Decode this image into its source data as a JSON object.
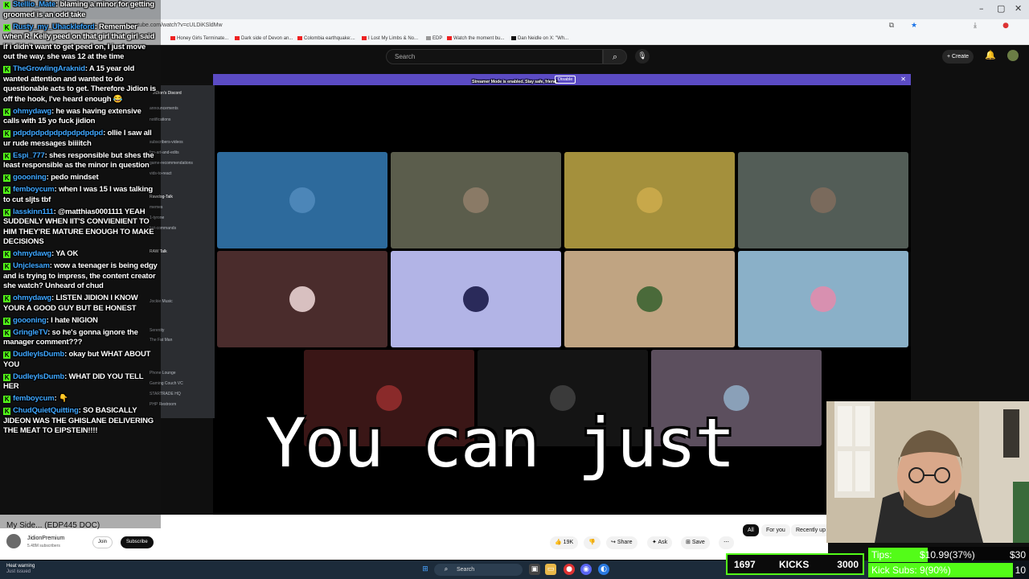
{
  "browser": {
    "url": "youtube.com/watch?v=cULDiKSldMw",
    "window_controls": [
      "–",
      "▢",
      "✕"
    ],
    "bookmarks": [
      "Honey Girls Terminate...",
      "Dark side of Devon an...",
      "Colombia earthquake:...",
      "I Lost My Limbs & No...",
      "EDP",
      "Watch the moment bu...",
      "Dan Neidle on X: \"Wh..."
    ]
  },
  "youtube": {
    "search_placeholder": "Search",
    "create_label": "+ Create",
    "video_title": "My Side... (EDP445 DOC)",
    "channel_name": "JidionPremium",
    "channel_subs": "5.48M subscribers",
    "join_label": "Join",
    "subscribe_label": "Subscribe",
    "like_count": "19K",
    "share_label": "Share",
    "ask_label": "Ask",
    "save_label": "Save",
    "chips": [
      "All",
      "For you",
      "Recently up"
    ]
  },
  "discord": {
    "streamer_msg": "Streamer Mode is enabled. Stay safe, friend.",
    "disable_label": "Disable",
    "server_name": "JiDion's Discord",
    "channels": [
      "announcements",
      "notifications",
      "subscribers-videos",
      "fan-art-and-edits",
      "game-recommendations",
      "vids-to-react",
      "Rawdog-Talk",
      "memes",
      "1-tyrone",
      "bot-commands",
      "RAW Talk",
      "Jockie Music",
      "Serenity",
      "The Fat Man",
      "Phone Lounge",
      "Gaming Couch VC",
      "STARTRADE HQ",
      "PHP Restroom"
    ]
  },
  "tiles": [
    {
      "bg": "#2d6a9c",
      "av": "#4c86b8"
    },
    {
      "bg": "#5b5d4c",
      "av": "#8a7a66"
    },
    {
      "bg": "#a4903c",
      "av": "#c8a84a"
    },
    {
      "bg": "#535d57",
      "av": "#7a6a5c"
    },
    {
      "bg": "#4a2c2c",
      "av": "#d8c0c0"
    },
    {
      "bg": "#b2b4e6",
      "av": "#2a2a5a"
    },
    {
      "bg": "#c0a482",
      "av": "#4a6a3a"
    },
    {
      "bg": "#8ab0c8",
      "av": "#d890b0"
    },
    {
      "bg": "#3a1616",
      "av": "#8a2a2a"
    },
    {
      "bg": "#141414",
      "av": "#3a3a3a"
    },
    {
      "bg": "#5c4f5e",
      "av": "#8aa0b8"
    }
  ],
  "subtitle": "You can just",
  "chat": [
    {
      "user": "Stellio_Mate",
      "text": "blaming a minor for getting groomed is an odd take"
    },
    {
      "user": "Rusty_my_Uhackleford",
      "text": "Remember when R. Kelly peed on that girl that girl said if i didn't want to get peed on, I just move out the way. she was 12 at the time"
    },
    {
      "user": "TheGrowlingAraknid",
      "text": "A 15 year old wanted attention and wanted to do questionable acts to get. Therefore Jidion is off the hook, I've heard enough 😂"
    },
    {
      "user": "ohmydawg",
      "text": "he was having extensive calls with 15 yo fuck jidion"
    },
    {
      "user": "pdpdpdpdpdpdpdpdpdpd",
      "text": "ollie I saw all ur rude messages biiiitch"
    },
    {
      "user": "Espi_777",
      "text": "shes responsible but shes the least responsible as the minor in question"
    },
    {
      "user": "goooning",
      "text": "pedo mindset"
    },
    {
      "user": "femboycum",
      "text": "when I was 15 I was talking to cut sljts tbf"
    },
    {
      "user": "lasskinn111",
      "text": "@matthias0001111 YEAH SUDDENLY WHEN IIT'S CONVIENIENT TO HIM THEY'RE MATURE ENOUGH TO MAKE DECISIONS"
    },
    {
      "user": "ohmydawg",
      "text": "YA OK"
    },
    {
      "user": "Unjclesam",
      "text": "wow a teenager is being edgy and is trying to impress, the content creator she watch? Unheard of chud"
    },
    {
      "user": "ohmydawg",
      "text": "LISTEN JIDION I KNOW YOUR A GOOD GUY BUT BE HONEST"
    },
    {
      "user": "goooning",
      "text": "I hate NIGION"
    },
    {
      "user": "GringleTV",
      "text": "so he's gonna ignore the manager comment???"
    },
    {
      "user": "DudleyIsDumb",
      "text": "okay but WHAT ABOUT YOU"
    },
    {
      "user": "DudleyIsDumb",
      "text": "WHAT DID YOU TELL HER"
    },
    {
      "user": "femboycum",
      "text": "👇"
    },
    {
      "user": "ChudQuietQuitting",
      "text": "SO BASICALLY JIDEON WAS THE GHISLANE DELIVERING THE MEAT TO EIPSTEIN!!!!"
    }
  ],
  "taskbar": {
    "weather_line1": "Heat warning",
    "weather_line2": "Just issued",
    "search_label": "Search"
  },
  "kicks": {
    "current": "1697",
    "label": "KICKS",
    "goal": "3000"
  },
  "goals": [
    {
      "label": "Tips:",
      "value": "$10.99(37%)",
      "target": "$30",
      "fraction": 0.37
    },
    {
      "label": "Kick Subs:",
      "value": "9(90%)",
      "target": "10",
      "fraction": 0.9
    }
  ],
  "colors": {
    "kick_green": "#53fc18",
    "discord_purple": "#5b4bc4",
    "yt_link_blue": "#3ea6ff"
  }
}
